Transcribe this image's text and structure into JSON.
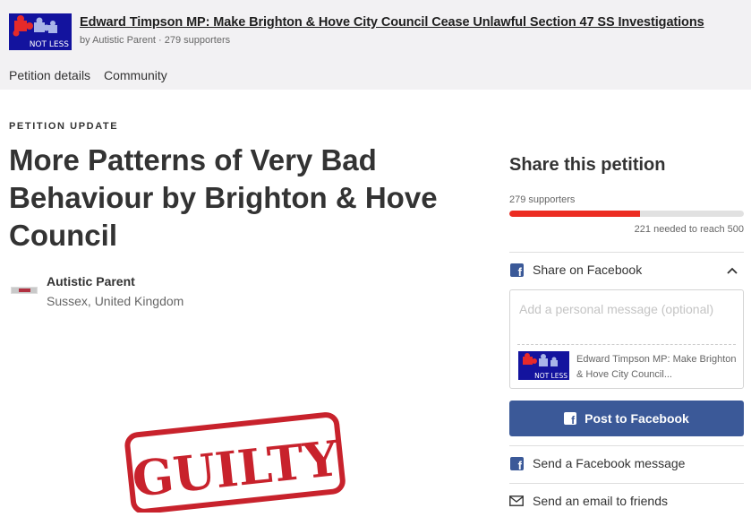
{
  "header": {
    "logo_text": "NOT LESS",
    "petition_title": "Edward Timpson MP: Make Brighton & Hove City Council Cease Unlawful Section 47 SS Investigations",
    "meta": "by Autistic Parent · 279 supporters",
    "tabs": [
      {
        "label": "Petition details"
      },
      {
        "label": "Community"
      }
    ]
  },
  "update": {
    "kicker": "PETITION UPDATE",
    "title": "More Patterns of Very Bad Behaviour by Brighton & Hove Council",
    "author_name": "Autistic Parent",
    "author_location": "Sussex, United Kingdom",
    "image_word": "GUILTY"
  },
  "share": {
    "title": "Share this petition",
    "supporters": "279 supporters",
    "progress_fraction": 0.558,
    "needed": "221 needed to reach 500",
    "facebook_label": "Share on Facebook",
    "message_placeholder": "Add a personal message (optional)",
    "preview_logo_text": "NOT LESS",
    "preview_title": "Edward Timpson MP: Make Brighton & Hove City Council...",
    "post_button": "Post to Facebook",
    "messenger_label": "Send a Facebook message",
    "email_label": "Send an email to friends"
  },
  "colors": {
    "facebook_blue": "#3b5998",
    "progress_red": "#ec2c22",
    "header_bg": "#f2f1f3"
  },
  "icons": [
    "facebook-icon",
    "chevron-up-icon",
    "mail-icon"
  ]
}
